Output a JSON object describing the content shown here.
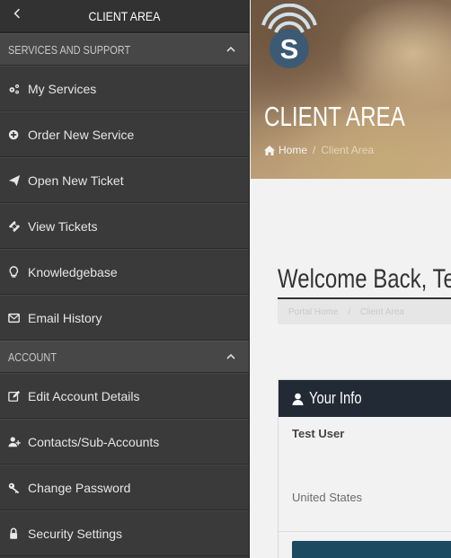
{
  "sidebar": {
    "title": "CLIENT AREA",
    "sections": [
      {
        "label": "SERVICES AND SUPPORT",
        "items": [
          {
            "label": "My Services",
            "icon": "cogs-icon"
          },
          {
            "label": "Order New Service",
            "icon": "plus-circle-icon"
          },
          {
            "label": "Open New Ticket",
            "icon": "paper-plane-icon"
          },
          {
            "label": "View Tickets",
            "icon": "ticket-icon"
          },
          {
            "label": "Knowledgebase",
            "icon": "lightbulb-icon"
          },
          {
            "label": "Email History",
            "icon": "envelope-icon"
          }
        ]
      },
      {
        "label": "ACCOUNT",
        "items": [
          {
            "label": "Edit Account Details",
            "icon": "edit-icon"
          },
          {
            "label": "Contacts/Sub-Accounts",
            "icon": "user-plus-icon"
          },
          {
            "label": "Change Password",
            "icon": "key-icon"
          },
          {
            "label": "Security Settings",
            "icon": "lock-icon"
          }
        ]
      }
    ]
  },
  "hero": {
    "logo_letter": "S",
    "title": "CLIENT AREA",
    "breadcrumb": {
      "home": "Home",
      "separator": "/",
      "current": "Client Area"
    }
  },
  "main": {
    "welcome": "Welcome Back, Test",
    "sub_breadcrumb": {
      "home": "Portal Home",
      "separator": "/",
      "current": "Client Area"
    },
    "panel": {
      "title": "Your Info",
      "user_name": "Test User",
      "country": "United States"
    }
  },
  "colors": {
    "sidebar_bg": "#3a3a3a",
    "section_bg": "#474747",
    "panel_header": "#222a35",
    "button": "#1b4a61",
    "logo_blue": "#3c5a74"
  }
}
